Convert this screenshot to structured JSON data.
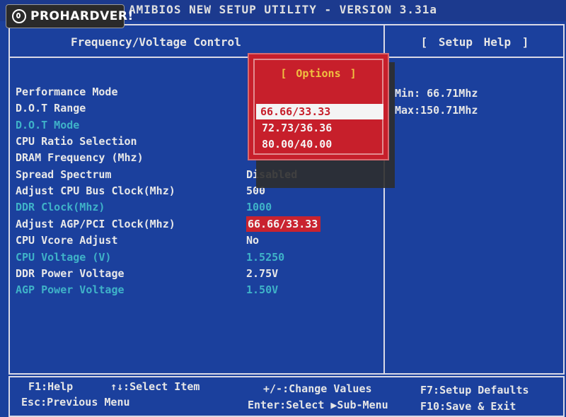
{
  "bios": {
    "title": "AMIBIOS NEW SETUP UTILITY - VERSION 3.31a",
    "panel_title": "Frequency/Voltage Control",
    "help_title": "[ Setup Help ]",
    "help_lines": [
      "Min: 66.71Mhz",
      "Max:150.71Mhz"
    ]
  },
  "settings": [
    {
      "label": "Performance Mode",
      "value": "",
      "disabled": false
    },
    {
      "label": "D.O.T Range",
      "value": "",
      "disabled": false
    },
    {
      "label": "D.O.T Mode",
      "value": "",
      "disabled": true
    },
    {
      "label": "CPU Ratio Selection",
      "value": "",
      "disabled": false
    },
    {
      "label": "DRAM Frequency (Mhz)",
      "value": "",
      "disabled": false
    },
    {
      "label": "Spread Spectrum",
      "value": "Disabled",
      "disabled": false
    },
    {
      "label": "Adjust CPU Bus Clock(Mhz)",
      "value": "500",
      "disabled": false
    },
    {
      "label": "DDR Clock(Mhz)",
      "value": "1000",
      "disabled": true
    },
    {
      "label": "Adjust AGP/PCI Clock(Mhz)",
      "value": "66.66/33.33",
      "disabled": false,
      "selected": true
    },
    {
      "label": "CPU Vcore Adjust",
      "value": "No",
      "disabled": false
    },
    {
      "label": "CPU Voltage (V)",
      "value": "1.5250",
      "disabled": true
    },
    {
      "label": "DDR Power Voltage",
      "value": "2.75V",
      "disabled": false
    },
    {
      "label": "AGP Power Voltage",
      "value": "1.50V",
      "disabled": true
    }
  ],
  "popup": {
    "title": "[ Options ]",
    "options": [
      "66.66/33.33",
      "72.73/36.36",
      "80.00/40.00"
    ],
    "highlighted_index": 0
  },
  "footer": {
    "f1": "F1:Help",
    "select_item": "↑↓:Select Item",
    "change_values": "+/-:Change Values",
    "f7": "F7:Setup Defaults",
    "esc": "Esc:Previous Menu",
    "enter": "Enter:Select ▶Sub-Menu",
    "f10": "F10:Save & Exit"
  },
  "logo": {
    "text": "PROHARDVER!"
  },
  "colors": {
    "background": "#1b409d",
    "popup": "#c71f2b",
    "disabled_text": "#3fb2c8",
    "popup_title": "#f0c040"
  }
}
